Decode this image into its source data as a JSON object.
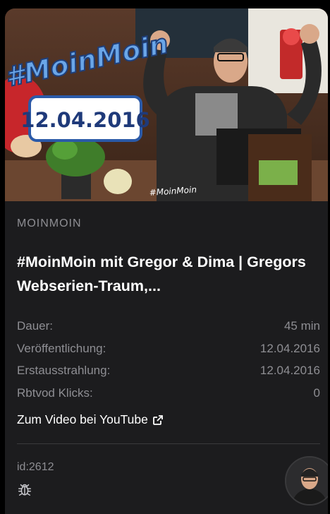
{
  "thumbnail": {
    "logo_text": "#MoinMoin",
    "date_sign": "12.04.2016",
    "mug_text": "#MoinMoin"
  },
  "channel": "MOINMOIN",
  "title": "#MoinMoin mit Gregor & Dima | Gregors Webserien-Traum,...",
  "meta": [
    {
      "label": "Dauer:",
      "value": "45 min"
    },
    {
      "label": "Veröffentlichung:",
      "value": "12.04.2016"
    },
    {
      "label": "Erstausstrahlung:",
      "value": "12.04.2016"
    },
    {
      "label": "Rbtvod Klicks:",
      "value": "0"
    }
  ],
  "youtube_link": {
    "label": "Zum Video bei YouTube",
    "icon": "external-link-icon"
  },
  "id_label": "id:2612",
  "bug_icon": "bug-icon",
  "avatar_icon": "user-avatar"
}
